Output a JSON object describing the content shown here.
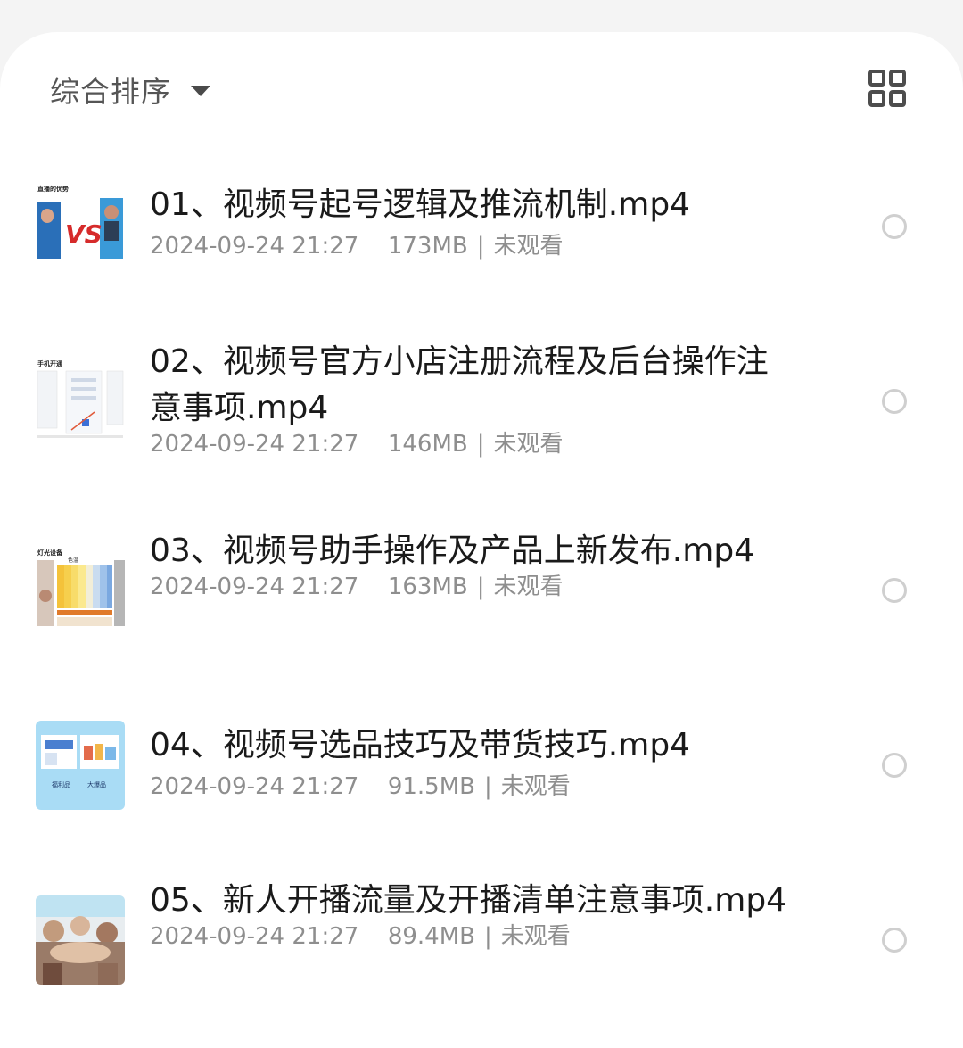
{
  "toolbar": {
    "sort_label": "综合排序",
    "sort_icon": "caret-down-icon",
    "view_toggle_icon": "grid-view-icon"
  },
  "thumbnails": {
    "t1_header": "直播的优势",
    "t2_header": "手机开通",
    "t3_header": "灯光设备",
    "t3_label": "色温",
    "t4_left": "福利品",
    "t4_right": "大爆品"
  },
  "files": [
    {
      "title": "01、视频号起号逻辑及推流机制.mp4",
      "date": "2024-09-24 21:27",
      "size": "173MB",
      "status": "未观看"
    },
    {
      "title": "02、视频号官方小店注册流程及后台操作注意事项.mp4",
      "date": "2024-09-24 21:27",
      "size": "146MB",
      "status": "未观看"
    },
    {
      "title": "03、视频号助手操作及产品上新发布.mp4",
      "date": "2024-09-24 21:27",
      "size": "163MB",
      "status": "未观看"
    },
    {
      "title": "04、视频号选品技巧及带货技巧.mp4",
      "date": "2024-09-24 21:27",
      "size": "91.5MB",
      "status": "未观看"
    },
    {
      "title": "05、新人开播流量及开播清单注意事项.mp4",
      "date": "2024-09-24 21:27",
      "size": "89.4MB",
      "status": "未观看"
    }
  ],
  "separator": "|"
}
